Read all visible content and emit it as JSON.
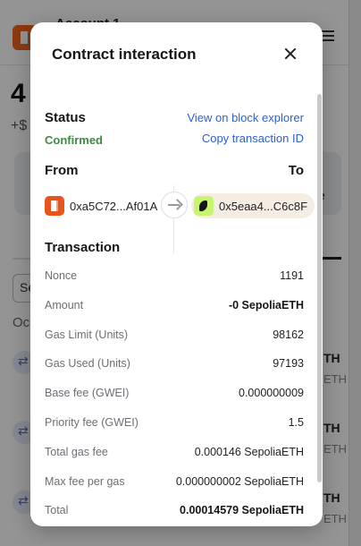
{
  "background": {
    "account_label": "Account 1",
    "balance": "4",
    "fiat": "+$",
    "card_letter": "e",
    "select_label": "Se",
    "date_label": "Oc",
    "tx_values": [
      "TH",
      "TH",
      "TH"
    ],
    "tx_subs": [
      "ETH",
      "ETH",
      "ETH"
    ]
  },
  "modal": {
    "title": "Contract interaction",
    "status": {
      "heading": "Status",
      "value": "Confirmed",
      "view_explorer": "View on block explorer",
      "copy_tx_id": "Copy transaction ID"
    },
    "from": {
      "heading": "From",
      "address": "0xa5C72...Af01A"
    },
    "to": {
      "heading": "To",
      "address": "0x5eaa4...C6c8F"
    },
    "transaction": {
      "heading": "Transaction",
      "rows": [
        {
          "label": "Nonce",
          "value": "1191"
        },
        {
          "label": "Amount",
          "value": "-0 SepoliaETH"
        },
        {
          "label": "Gas Limit (Units)",
          "value": "98162"
        },
        {
          "label": "Gas Used (Units)",
          "value": "97193"
        },
        {
          "label": "Base fee (GWEI)",
          "value": "0.000000009"
        },
        {
          "label": "Priority fee (GWEI)",
          "value": "1.5"
        },
        {
          "label": "Total gas fee",
          "value": "0.000146 SepoliaETH"
        },
        {
          "label": "Max fee per gas",
          "value": "0.000000002 SepoliaETH"
        },
        {
          "label": "Total",
          "value": "0.00014579 SepoliaETH"
        }
      ]
    }
  },
  "colors": {
    "link": "#2c5fd4",
    "confirmed": "#3d8b40",
    "overlay": "rgba(0,0,0,0.42)"
  },
  "icons": {
    "close": "close-icon",
    "from_avatar": "metamask-fox-icon",
    "to_avatar": "token-avatar-icon",
    "arrow": "arrow-right-icon"
  }
}
